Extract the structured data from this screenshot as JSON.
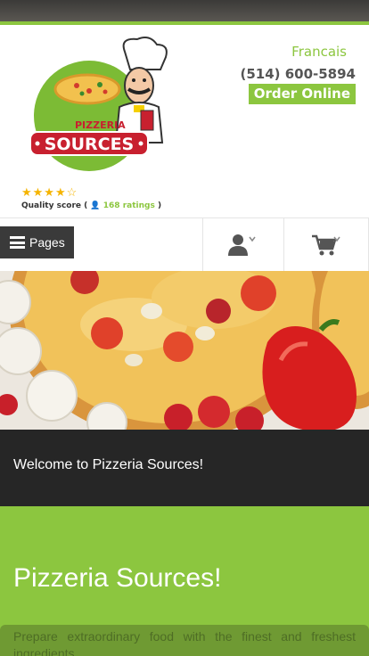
{
  "header": {
    "logo_top_text": "PIZZERIA",
    "logo_main_text": "SOURCES",
    "language_link": "Francais",
    "phone": "(514) 600-5894",
    "order_button": "Order Online",
    "rating": {
      "stars": "★★★★☆",
      "value": 4,
      "max": 5,
      "quality_label": "Quality score (",
      "ratings_count": "168 ratings",
      "close_paren": ")"
    }
  },
  "nav": {
    "pages_label": "Pages",
    "user_icon": "user-icon",
    "cart_icon": "shopping-cart-icon"
  },
  "welcome": {
    "text": "Welcome to Pizzeria Sources!"
  },
  "section": {
    "heading": "Pizzeria Sources!",
    "intro": "Prepare extraordinary food with the finest and freshest ingredients"
  },
  "colors": {
    "brand_green": "#8cc63f",
    "dark": "#262626",
    "logo_red": "#c8202f"
  }
}
